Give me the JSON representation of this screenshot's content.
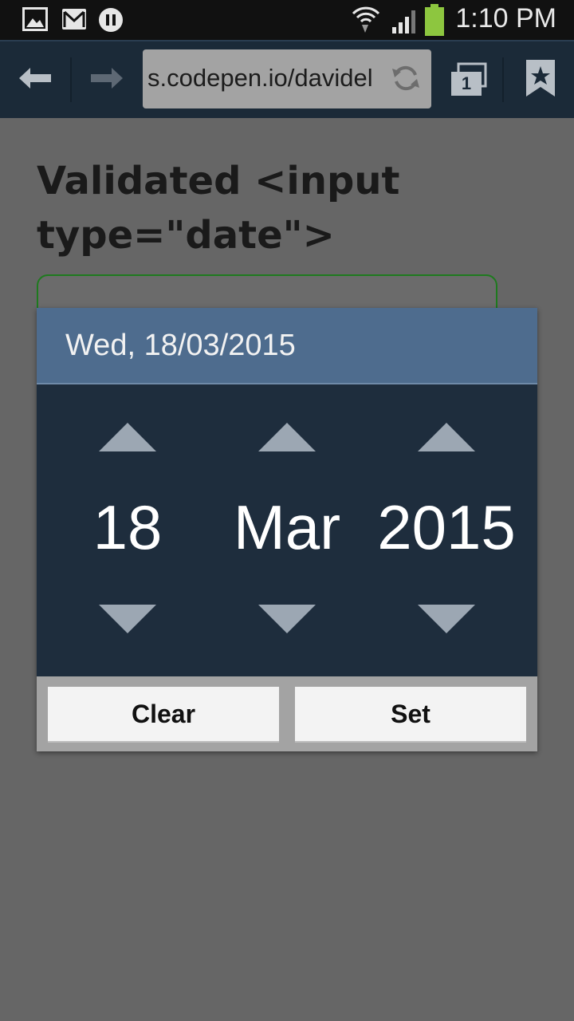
{
  "status_bar": {
    "time": "1:10 PM",
    "icons": [
      "gallery-icon",
      "gmail-icon",
      "media-pause-icon",
      "wifi-icon",
      "signal-icon",
      "battery-icon"
    ]
  },
  "browser": {
    "url": "s.codepen.io/davidel",
    "tab_count": "1",
    "icons": [
      "back-icon",
      "forward-icon",
      "reload-icon",
      "tabs-icon",
      "bookmark-icon"
    ]
  },
  "page": {
    "title": "Validated <input type=\"date\">"
  },
  "date_dialog": {
    "header": "Wed, 18/03/2015",
    "day": "18",
    "month": "Mar",
    "year": "2015",
    "clear_label": "Clear",
    "set_label": "Set"
  },
  "colors": {
    "status_bar": "#111111",
    "toolbar": "#1b2a38",
    "page_bg": "#666666",
    "dialog_header": "#4e6c8e",
    "picker_bg": "#1e2d3d",
    "input_border": "#1e7a1e"
  }
}
